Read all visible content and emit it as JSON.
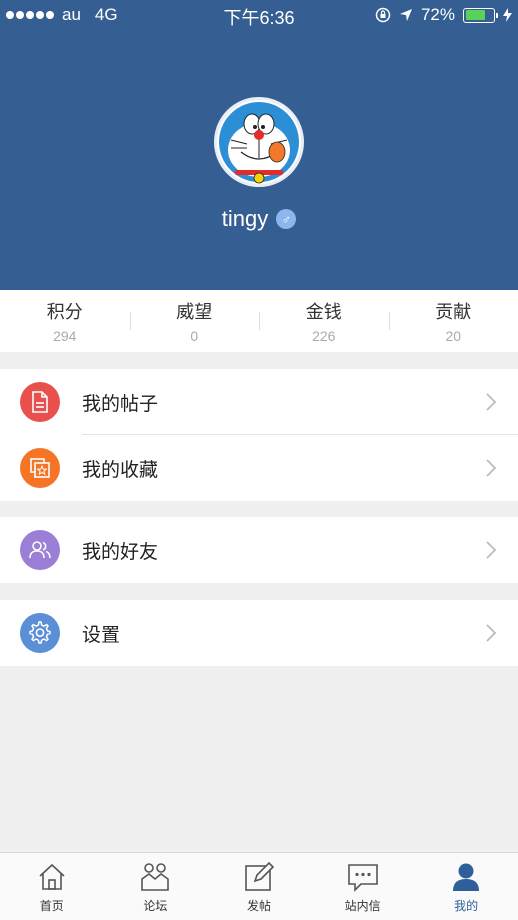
{
  "status_bar": {
    "carrier": "au",
    "network": "4G",
    "time": "下午6:36",
    "battery_percent": "72%",
    "battery_level": 0.72
  },
  "profile": {
    "username": "tingy",
    "gender_symbol": "♂",
    "colors": {
      "header_bg": "#355f93",
      "gender_badge": "#8db6ef"
    }
  },
  "stats": [
    {
      "label": "积分",
      "value": "294"
    },
    {
      "label": "威望",
      "value": "0"
    },
    {
      "label": "金钱",
      "value": "226"
    },
    {
      "label": "贡献",
      "value": "20"
    }
  ],
  "menu": {
    "posts": {
      "label": "我的帖子",
      "icon": "document-icon",
      "color": "#e8504d"
    },
    "favorites": {
      "label": "我的收藏",
      "icon": "favorite-star-icon",
      "color": "#f57425"
    },
    "friends": {
      "label": "我的好友",
      "icon": "friends-icon",
      "color": "#9b7fd6"
    },
    "settings": {
      "label": "设置",
      "icon": "gear-icon",
      "color": "#5b8fd6"
    }
  },
  "tabbar": [
    {
      "label": "首页",
      "icon": "home-icon",
      "active": false
    },
    {
      "label": "论坛",
      "icon": "forum-icon",
      "active": false
    },
    {
      "label": "发帖",
      "icon": "compose-icon",
      "active": false
    },
    {
      "label": "站内信",
      "icon": "message-icon",
      "active": false
    },
    {
      "label": "我的",
      "icon": "profile-icon",
      "active": true
    }
  ]
}
